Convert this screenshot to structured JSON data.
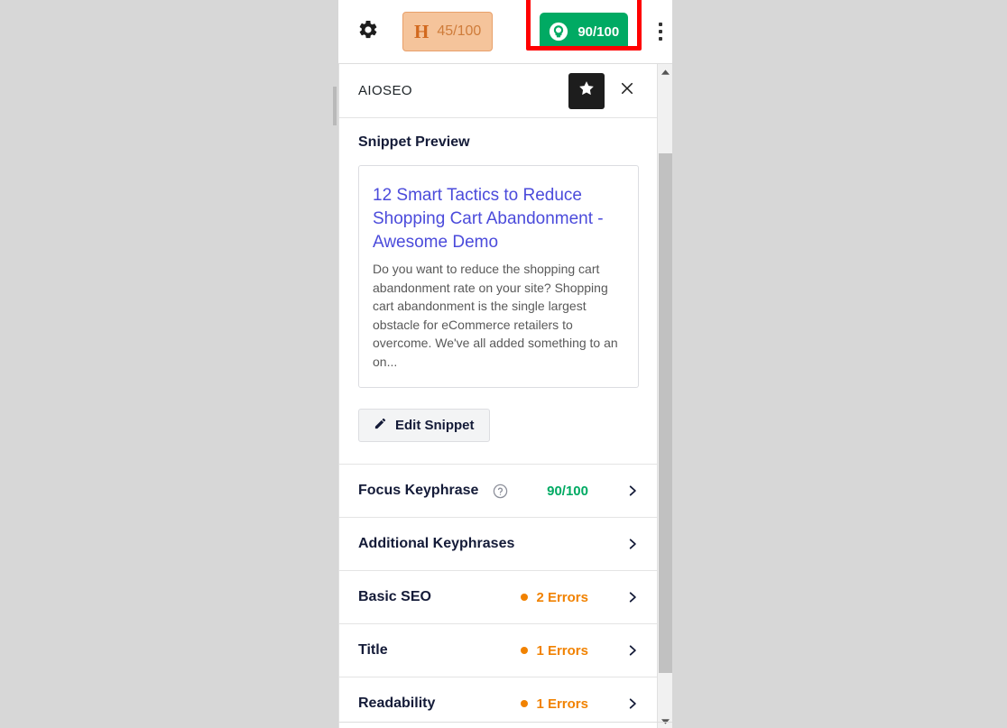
{
  "toolbar": {
    "gear_icon": "gear-icon",
    "hscore": {
      "letter": "H",
      "value": "45/100"
    },
    "aioseo_score": {
      "icon": "aioseo-logo-icon",
      "value": "90/100",
      "highlight_color": "#ff0000",
      "badge_color": "#00aa63"
    },
    "kebab_icon": "more-vertical-icon"
  },
  "panel": {
    "title": "AIOSEO",
    "star_icon": "star-icon",
    "close_icon": "close-icon",
    "snippet": {
      "heading": "Snippet Preview",
      "title": "12 Smart Tactics to Reduce Shopping Cart Abandonment - Awesome Demo",
      "description": "Do you want to reduce the shopping cart abandonment rate on your site? Shopping cart abandonment is the single largest obstacle for eCommerce retailers to overcome. We've all added something to an on...",
      "edit_button": "Edit Snippet",
      "edit_icon": "pencil-icon"
    },
    "rows": [
      {
        "label": "Focus Keyphrase",
        "help_icon": "help-circle-icon",
        "score": "90/100",
        "score_color": "#00aa63",
        "chevron_icon": "chevron-right-icon"
      },
      {
        "label": "Additional Keyphrases",
        "chevron_icon": "chevron-right-icon"
      },
      {
        "label": "Basic SEO",
        "errors": "2 Errors",
        "error_color": "#f18200",
        "chevron_icon": "chevron-right-icon"
      },
      {
        "label": "Title",
        "errors": "1 Errors",
        "error_color": "#f18200",
        "chevron_icon": "chevron-right-icon"
      },
      {
        "label": "Readability",
        "errors": "1 Errors",
        "error_color": "#f18200",
        "chevron_icon": "chevron-right-icon"
      }
    ],
    "scrollbar": {
      "up_icon": "scroll-up-arrow-icon",
      "down_icon": "scroll-down-arrow-icon"
    }
  }
}
